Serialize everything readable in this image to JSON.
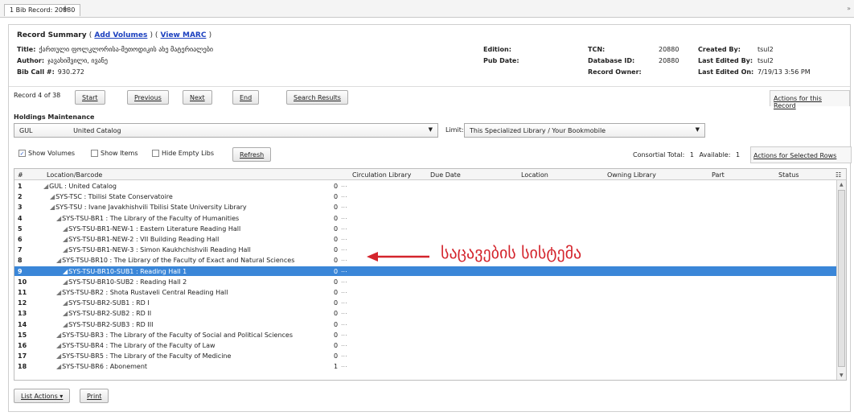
{
  "tab": {
    "label": "1 Bib Record: 20880",
    "plus": "+",
    "scroll": "»"
  },
  "summary": {
    "title": "Record Summary",
    "open_paren": "(",
    "add_volumes": "Add Volumes",
    "mid_sep": ") (",
    "view_marc": "View MARC",
    "close_paren": ")",
    "title_label": "Title:",
    "title_value": "ქართული ფოლკლორისა-მეთოდიკის ახე მატერიალები",
    "author_label": "Author:",
    "author_value": "ჯავახიშვილი, ივანე",
    "bibcall_label": "Bib Call #:",
    "bibcall_value": "930.272",
    "edition_label": "Edition:",
    "edition_value": "",
    "pubdate_label": "Pub Date:",
    "pubdate_value": "",
    "tcn_label": "TCN:",
    "tcn_value": "20880",
    "dbid_label": "Database ID:",
    "dbid_value": "20880",
    "owner_label": "Record Owner:",
    "owner_value": "",
    "created_label": "Created By:",
    "created_value": "tsul2",
    "edited_label": "Last Edited By:",
    "edited_value": "tsul2",
    "editedon_label": "Last Edited On:",
    "editedon_value": "7/19/13 3:56 PM"
  },
  "nav": {
    "record_label": "Record 4 of 38",
    "start": "Start",
    "previous": "Previous",
    "next": "Next",
    "end": "End",
    "search_results": "Search Results",
    "actions_record": "Actions for this Record"
  },
  "holdings": {
    "title": "Holdings Maintenance",
    "lib_code": "GUL",
    "lib_name": "United Catalog",
    "limit_label": "Limit:",
    "limit_value": "This Specialized Library / Your Bookmobile",
    "show_volumes": "Show Volumes",
    "show_items": "Show Items",
    "hide_empty": "Hide Empty Libs",
    "refresh": "Refresh",
    "consortial_label": "Consortial Total:",
    "consortial_value": "1",
    "available_label": "Available:",
    "available_value": "1",
    "actions_rows": "Actions for Selected Rows"
  },
  "grid": {
    "headers": {
      "num": "#",
      "location": "Location/Barcode",
      "circ": "Circulation Library",
      "due": "Due Date",
      "loc": "Location",
      "owning": "Owning Library",
      "part": "Part",
      "status": "Status",
      "picker": "☷"
    },
    "rows": [
      {
        "num": "1",
        "text": "GUL : United Catalog",
        "count": "0",
        "dots": "...",
        "level": 0
      },
      {
        "num": "2",
        "text": "SYS-TSC : Tbilisi State Conservatoire",
        "count": "0",
        "dots": "...",
        "level": 1
      },
      {
        "num": "3",
        "text": "SYS-TSU : Ivane Javakhishvili Tbilisi State University Library",
        "count": "0",
        "dots": "...",
        "level": 1
      },
      {
        "num": "4",
        "text": "SYS-TSU-BR1 : The Library of the Faculty of Humanities",
        "count": "0",
        "dots": "...",
        "level": 2
      },
      {
        "num": "5",
        "text": "SYS-TSU-BR1-NEW-1 : Eastern Literature Reading Hall",
        "count": "0",
        "dots": "...",
        "level": 3
      },
      {
        "num": "6",
        "text": "SYS-TSU-BR1-NEW-2 : VII Building Reading Hall",
        "count": "0",
        "dots": "...",
        "level": 3
      },
      {
        "num": "7",
        "text": "SYS-TSU-BR1-NEW-3 : Simon Kaukhchishvili Reading Hall",
        "count": "0",
        "dots": "...",
        "level": 3
      },
      {
        "num": "8",
        "text": "SYS-TSU-BR10 : The Library of the Faculty of Exact and Natural Sciences",
        "count": "0",
        "dots": "...",
        "level": 2
      },
      {
        "num": "9",
        "text": "SYS-TSU-BR10-SUB1 : Reading Hall 1",
        "count": "0",
        "dots": "...",
        "level": 3
      },
      {
        "num": "10",
        "text": "SYS-TSU-BR10-SUB2 : Reading Hall 2",
        "count": "0",
        "dots": "...",
        "level": 3
      },
      {
        "num": "11",
        "text": "SYS-TSU-BR2 : Shota Rustaveli Central Reading Hall",
        "count": "0",
        "dots": "...",
        "level": 2
      },
      {
        "num": "12",
        "text": "SYS-TSU-BR2-SUB1 : RD I",
        "count": "0",
        "dots": "...",
        "level": 3
      },
      {
        "num": "13",
        "text": "SYS-TSU-BR2-SUB2 : RD II",
        "count": "0",
        "dots": "...",
        "level": 3
      },
      {
        "num": "14",
        "text": "SYS-TSU-BR2-SUB3 : RD III",
        "count": "0",
        "dots": "...",
        "level": 3
      },
      {
        "num": "15",
        "text": "SYS-TSU-BR3 : The Library of the Faculty of Social and Political Sciences",
        "count": "0",
        "dots": "...",
        "level": 2
      },
      {
        "num": "16",
        "text": "SYS-TSU-BR4 : The Library of the Faculty of Law",
        "count": "0",
        "dots": "...",
        "level": 2
      },
      {
        "num": "17",
        "text": "SYS-TSU-BR5 : The Library of the Faculty of Medicine",
        "count": "0",
        "dots": "...",
        "level": 2
      },
      {
        "num": "18",
        "text": "SYS-TSU-BR6 : Abonement",
        "count": "1",
        "dots": "...",
        "level": 2
      }
    ],
    "selected_row": "9"
  },
  "bottom": {
    "list_actions": "List Actions ▾",
    "print": "Print"
  },
  "annotation": {
    "text": "საცავების სისტემა",
    "color": "#d4242c"
  },
  "colors": {
    "link": "#1a3fbf",
    "selection": "#3a86d8"
  }
}
